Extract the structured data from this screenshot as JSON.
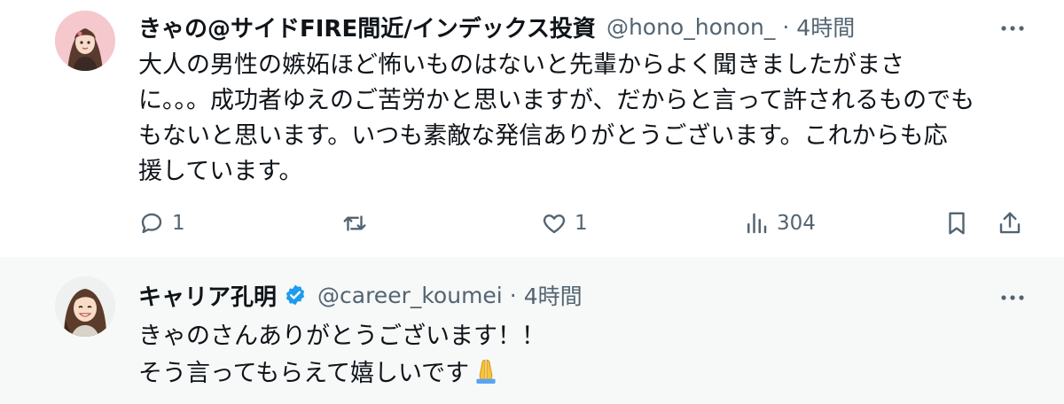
{
  "post1": {
    "author_name": "きゃの@サイドFIRE間近/インデックス投資",
    "handle": "@hono_honon_",
    "dot": "·",
    "time": "4時間",
    "body_lines": [
      "大人の男性の嫉妬ほど怖いものはないと先輩からよく聞きましたがまさ",
      "に。。。成功者ゆえのご苦労かと思いますが、だからと言って許されるものでも",
      "もないと思います。いつも素敵な発信ありがとうございます。これからも応",
      "援しています。"
    ],
    "actions": {
      "reply_count": "1",
      "repost_count": "",
      "like_count": "1",
      "views_count": "304"
    },
    "icons": [
      "reply-icon",
      "repost-icon",
      "like-icon",
      "views-icon",
      "bookmark-icon",
      "share-icon",
      "more-icon"
    ]
  },
  "post2": {
    "author_name": "キャリア孔明",
    "verified": true,
    "handle": "@career_koumei",
    "dot": "·",
    "time": "4時間",
    "body_lines": [
      "きゃのさんありがとうございます！！",
      "そう言ってもらえて嬉しいです"
    ],
    "emoji": "folded-hands",
    "icons": [
      "verified-badge-icon",
      "more-icon",
      "folded-hands-emoji"
    ]
  },
  "colors": {
    "text_primary": "#0f1419",
    "text_secondary": "#536471",
    "verified_blue": "#1d9bf0",
    "thread_line": "#cfd9de",
    "reply_background": "#f7f9f9"
  }
}
